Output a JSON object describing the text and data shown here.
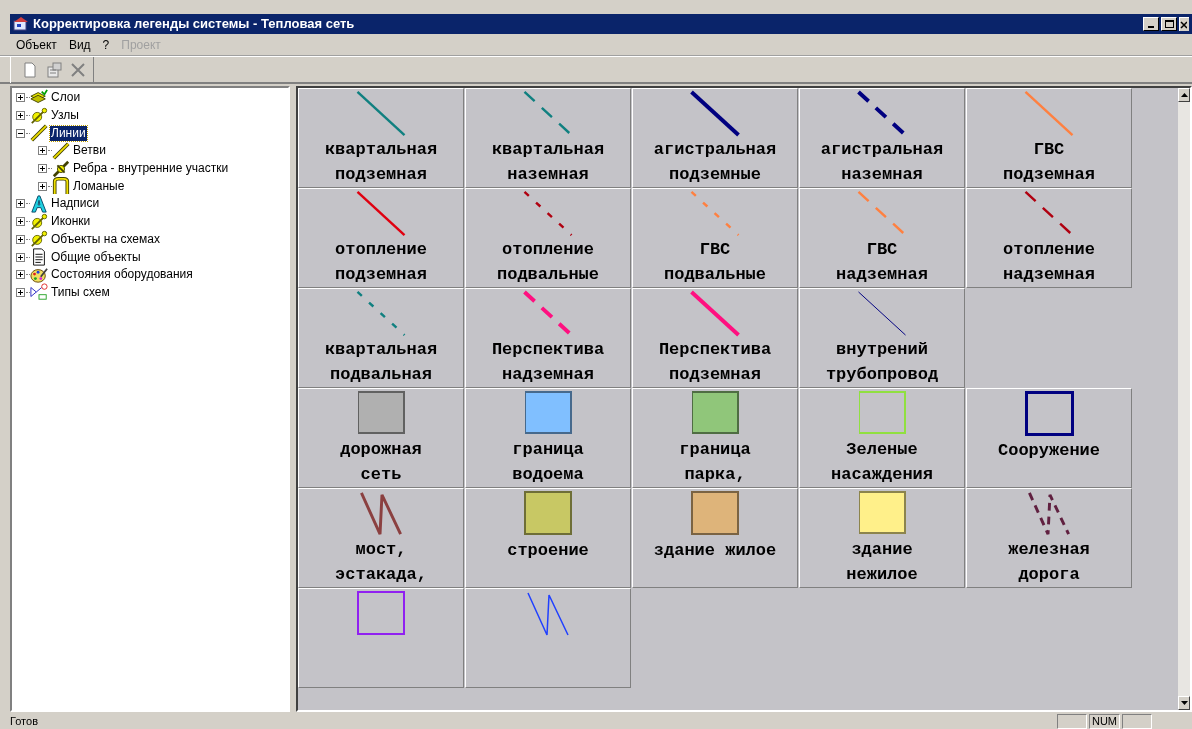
{
  "window": {
    "title": "Корректировка легенды системы - Тепловая сеть"
  },
  "menu": [
    {
      "label": "Объект",
      "disabled": false
    },
    {
      "label": "Вид",
      "disabled": false
    },
    {
      "label": "?",
      "disabled": false
    },
    {
      "label": "Проект",
      "disabled": true
    }
  ],
  "toolbar": [
    {
      "kind": "new",
      "disabled": true
    },
    {
      "kind": "properties",
      "disabled": true
    },
    {
      "kind": "delete",
      "disabled": true
    }
  ],
  "tree": [
    {
      "label": "Слои",
      "kind": "layers",
      "expanded": false,
      "selected": false
    },
    {
      "label": "Узлы",
      "kind": "node",
      "expanded": false,
      "selected": false
    },
    {
      "label": "Линии",
      "kind": "pencil",
      "expanded": true,
      "selected": true,
      "children": [
        {
          "label": "Ветви",
          "kind": "pencil",
          "expanded": false,
          "selected": false
        },
        {
          "label": "Ребра - внутренние участки",
          "kind": "edge",
          "expanded": false,
          "selected": false
        },
        {
          "label": "Ломаные",
          "kind": "polyline",
          "expanded": false,
          "selected": false
        }
      ]
    },
    {
      "label": "Надписи",
      "kind": "letter",
      "expanded": false,
      "selected": false
    },
    {
      "label": "Иконки",
      "kind": "node",
      "expanded": false,
      "selected": false
    },
    {
      "label": "Объекты на схемах",
      "kind": "node",
      "expanded": false,
      "selected": false
    },
    {
      "label": "Общие объекты",
      "kind": "document",
      "expanded": false,
      "selected": false
    },
    {
      "label": "Состояния оборудования",
      "kind": "palette",
      "expanded": false,
      "selected": false
    },
    {
      "label": "Типы схем",
      "kind": "schema",
      "expanded": false,
      "selected": false
    }
  ],
  "legend_groups": [
    {
      "items": [
        {
          "kind": "line",
          "color": "#108080",
          "label": [
            "квартальная",
            "подземная"
          ]
        },
        {
          "kind": "dashed",
          "color": "#108080",
          "label": [
            "квартальная",
            "наземная"
          ]
        },
        {
          "kind": "thickline",
          "color": "#000080",
          "label": [
            "агистральная",
            "подземные"
          ]
        },
        {
          "kind": "thickdashed",
          "color": "#000080",
          "label": [
            "агистральная",
            "наземная"
          ]
        },
        {
          "kind": "line",
          "color": "#ff8040",
          "label": [
            "ГВС",
            "подземная"
          ]
        },
        {
          "kind": "line",
          "color": "#e00010",
          "label": [
            "отопление",
            "подземная"
          ]
        },
        {
          "kind": "dotted",
          "color": "#b00010",
          "label": [
            "отопление",
            "подвальные"
          ]
        },
        {
          "kind": "dotted",
          "color": "#ff8040",
          "label": [
            "ГВС",
            "подвальные"
          ]
        },
        {
          "kind": "dashed",
          "color": "#ff8040",
          "label": [
            "ГВС",
            "надземная"
          ]
        },
        {
          "kind": "dashed",
          "color": "#b00010",
          "label": [
            "отопление",
            "надземная"
          ]
        },
        {
          "kind": "dotted",
          "color": "#108080",
          "label": [
            "квартальная",
            "подвальная"
          ]
        },
        {
          "kind": "thickdashed",
          "color": "#ff1080",
          "label": [
            "Перспектива",
            "надземная"
          ]
        },
        {
          "kind": "thickline",
          "color": "#ff1080",
          "label": [
            "Перспектива",
            "подземная"
          ]
        },
        {
          "kind": "thinline",
          "color": "#000080",
          "label": [
            "внутрений",
            "трубопровод"
          ]
        }
      ]
    },
    {
      "items": [
        {
          "kind": "area",
          "color": "#b0b0b0",
          "label": [
            "дорожная",
            "сеть"
          ]
        },
        {
          "kind": "area",
          "color": "#80bfff",
          "label": [
            "граница",
            "водоема"
          ]
        },
        {
          "kind": "area",
          "color": "#90c67a",
          "label": [
            "граница",
            "парка,"
          ]
        },
        {
          "kind": "outline",
          "color": "#90e040",
          "label": [
            "Зеленые",
            "насаждения"
          ]
        },
        {
          "kind": "thickoutline",
          "color": "#000080",
          "label": [
            "Сооружение"
          ]
        },
        {
          "kind": "zigzag",
          "color": "#8b4040",
          "label": [
            "мост,",
            "эстакада,"
          ]
        },
        {
          "kind": "area",
          "color": "#c8c864",
          "label": [
            "строение"
          ]
        },
        {
          "kind": "area",
          "color": "#deb47a",
          "label": [
            "здание жилое"
          ]
        },
        {
          "kind": "area",
          "color": "#fff08a",
          "label": [
            "здание",
            "нежилое"
          ]
        },
        {
          "kind": "dashedzigzag",
          "color": "#602040",
          "label": [
            "железная",
            "дорога"
          ]
        },
        {
          "kind": "outline",
          "color": "#9020f0"
        },
        {
          "kind": "thinzigzag",
          "color": "#2040ff"
        }
      ]
    }
  ],
  "status_bar": {
    "message": "Готов",
    "panels": [
      "NUM"
    ]
  }
}
